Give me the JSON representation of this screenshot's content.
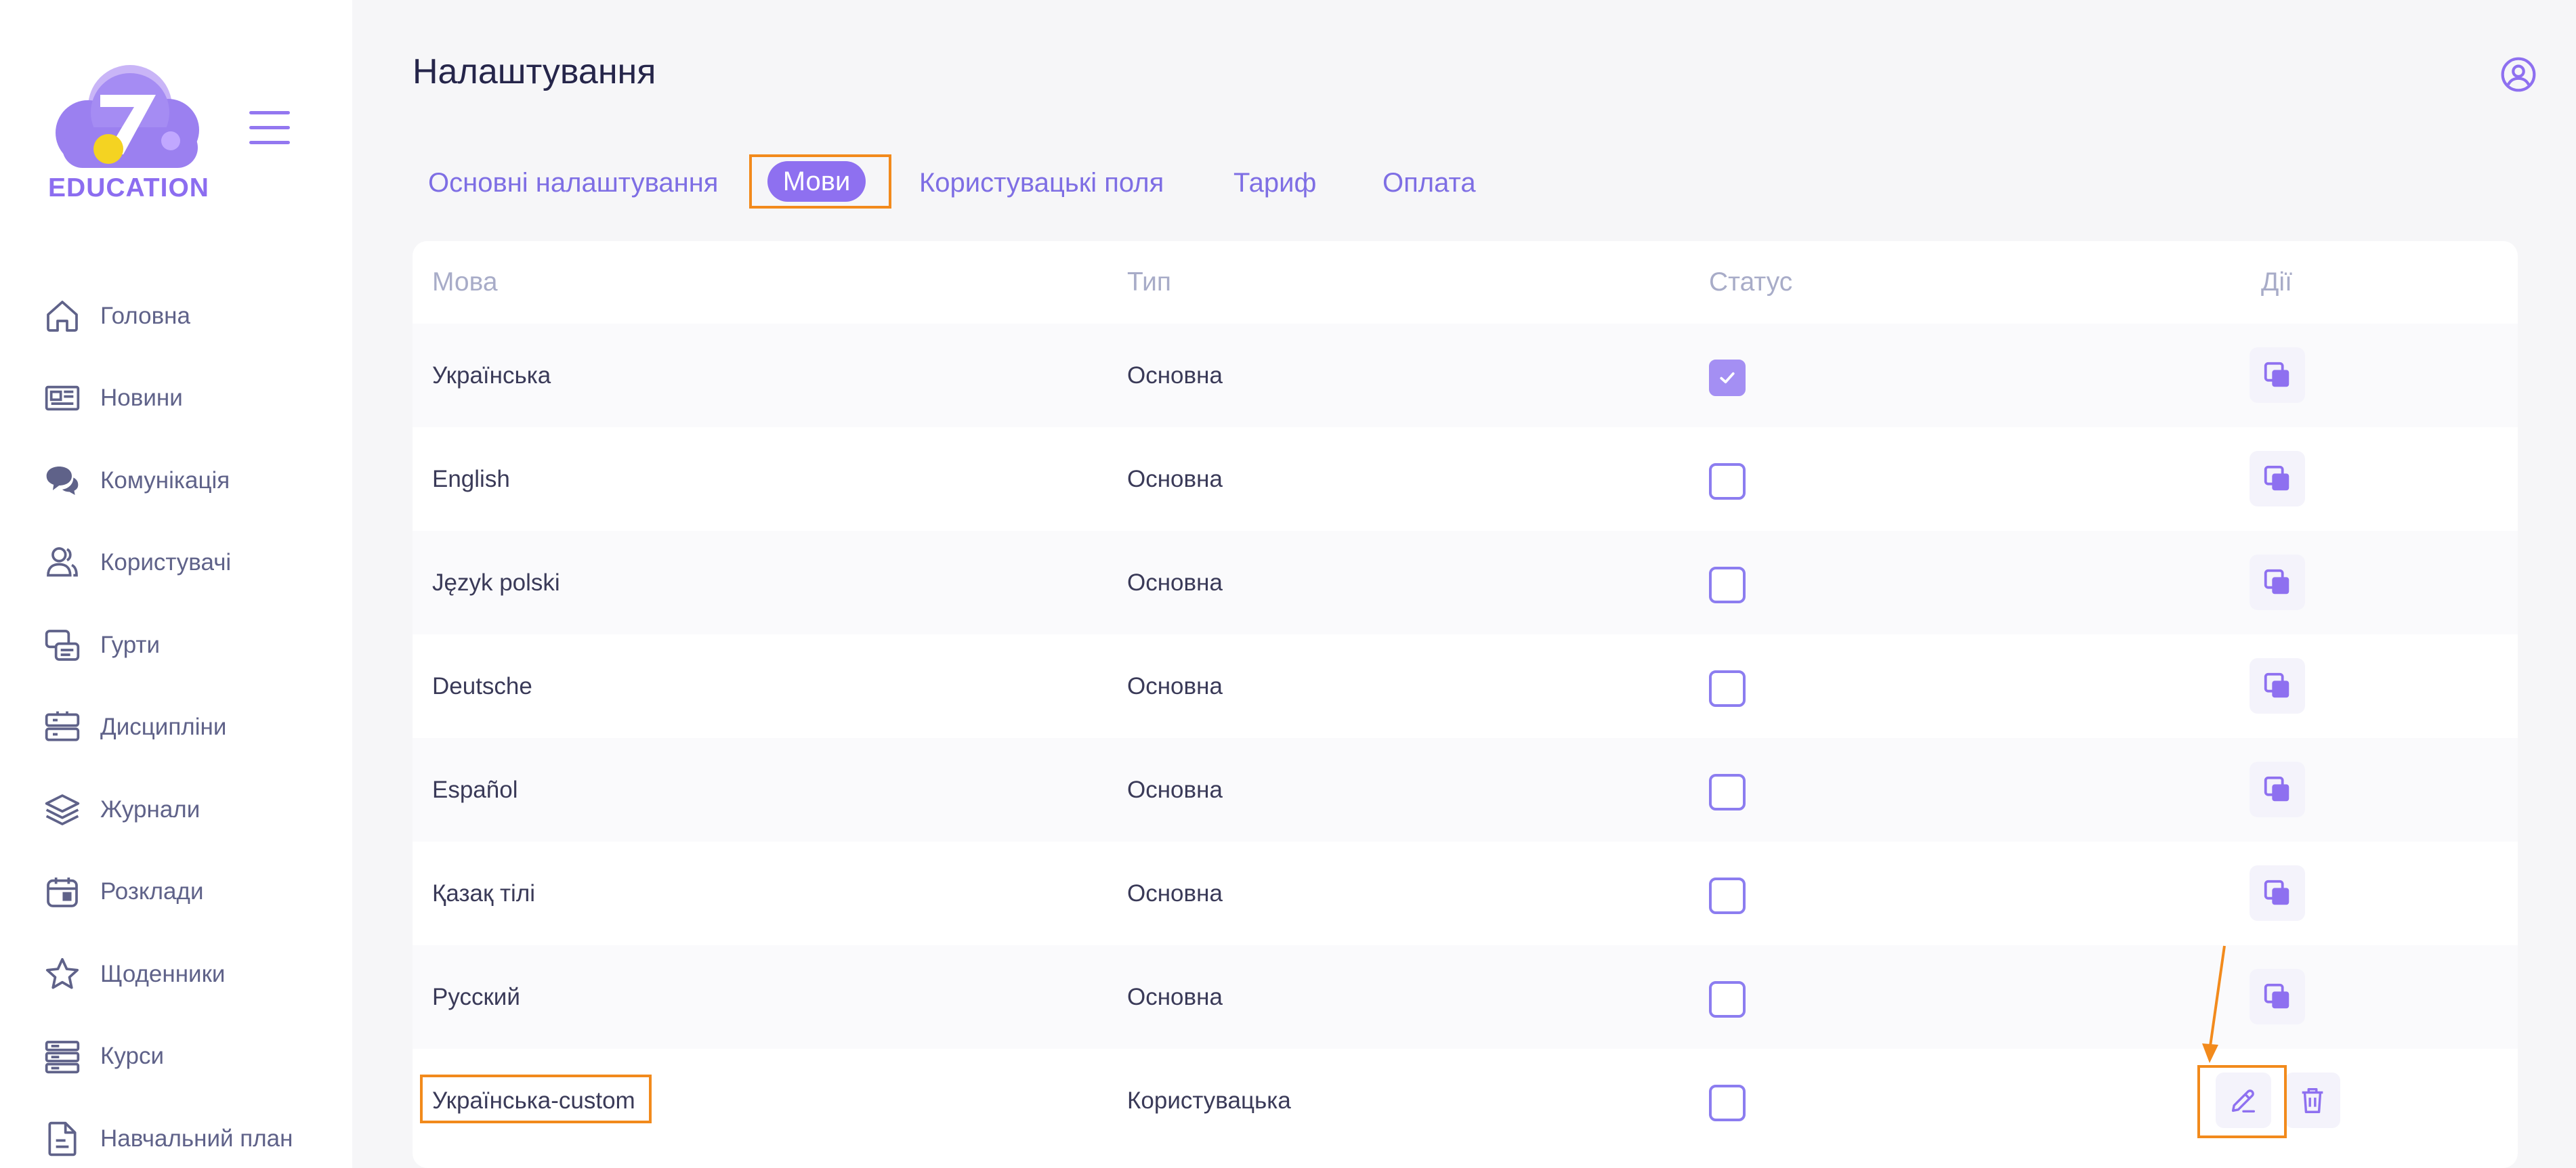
{
  "sidebar": {
    "logo_text": "EDUCATION",
    "items": [
      {
        "label": "Головна",
        "icon": "home-icon"
      },
      {
        "label": "Новини",
        "icon": "newspaper-icon"
      },
      {
        "label": "Комунікація",
        "icon": "chat-icon"
      },
      {
        "label": "Користувачі",
        "icon": "users-icon"
      },
      {
        "label": "Гурти",
        "icon": "groups-icon"
      },
      {
        "label": "Дисципліни",
        "icon": "disciplines-icon"
      },
      {
        "label": "Журнали",
        "icon": "layers-icon"
      },
      {
        "label": "Розклади",
        "icon": "calendar-icon"
      },
      {
        "label": "Щоденники",
        "icon": "star-icon"
      },
      {
        "label": "Курси",
        "icon": "server-icon"
      },
      {
        "label": "Навчальний план",
        "icon": "document-icon"
      }
    ]
  },
  "header": {
    "title": "Налаштування"
  },
  "tabs": [
    {
      "label": "Основні налаштування"
    },
    {
      "label": "Мови",
      "active": true
    },
    {
      "label": "Користувацькі поля"
    },
    {
      "label": "Тариф"
    },
    {
      "label": "Оплата"
    }
  ],
  "table": {
    "columns": [
      "Мова",
      "Тип",
      "Статус",
      "Дії"
    ],
    "rows": [
      {
        "language": "Українська",
        "type": "Основна",
        "status": true
      },
      {
        "language": "English",
        "type": "Основна",
        "status": false
      },
      {
        "language": "Język polski",
        "type": "Основна",
        "status": false
      },
      {
        "language": "Deutsche",
        "type": "Основна",
        "status": false
      },
      {
        "language": "Español",
        "type": "Основна",
        "status": false
      },
      {
        "language": "Қазақ тілі",
        "type": "Основна",
        "status": false
      },
      {
        "language": "Русский",
        "type": "Основна",
        "status": false
      },
      {
        "language": "Українська-custom",
        "type": "Користувацька",
        "status": false
      }
    ]
  },
  "colors": {
    "accent": "#8e70f0",
    "highlight": "#f28a1c",
    "sidebar_text": "#5f6289",
    "header_text": "#a8acc8"
  }
}
